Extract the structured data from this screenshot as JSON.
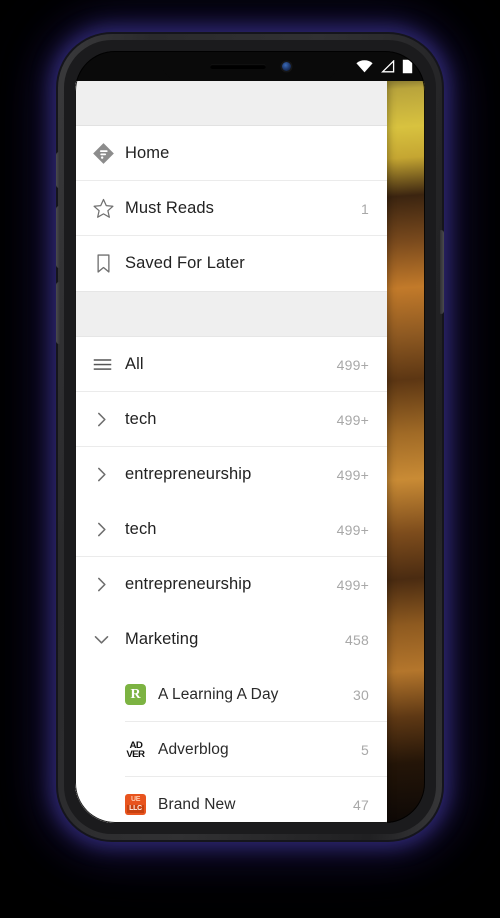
{
  "status_bar": {
    "icons": [
      "wifi-icon",
      "signal-icon",
      "battery-icon"
    ]
  },
  "drawer": {
    "top_items": [
      {
        "label": "Home",
        "count": "",
        "icon": "feedly-logo-icon"
      },
      {
        "label": "Must Reads",
        "count": "1",
        "icon": "star-icon"
      },
      {
        "label": "Saved For Later",
        "count": "",
        "icon": "bookmark-icon"
      }
    ],
    "feed_items": [
      {
        "label": "All",
        "count": "499+",
        "icon": "hamburger-icon"
      },
      {
        "label": "tech",
        "count": "499+",
        "icon": "chevron-right-icon"
      },
      {
        "label": "entrepreneurship",
        "count": "499+",
        "icon": "chevron-right-icon"
      },
      {
        "label": "tech",
        "count": "499+",
        "icon": "chevron-right-icon"
      },
      {
        "label": "entrepreneurship",
        "count": "499+",
        "icon": "chevron-right-icon"
      },
      {
        "label": "Marketing",
        "count": "458",
        "icon": "chevron-down-icon"
      }
    ],
    "marketing_sources": [
      {
        "label": "A Learning A Day",
        "count": "30",
        "icon": "a-learning-a-day-favicon",
        "favicon_text": "R",
        "favicon_color": "#7cb342"
      },
      {
        "label": "Adverblog",
        "count": "5",
        "icon": "adverblog-favicon",
        "favicon_line1": "AD",
        "favicon_line2": "VER",
        "favicon_color": "#111111"
      },
      {
        "label": "Brand New",
        "count": "47",
        "icon": "brand-new-favicon",
        "favicon_line1": "UE",
        "favicon_line2": "LLC",
        "favicon_color": "#e8541e"
      }
    ]
  },
  "colors": {
    "header_gray": "#efefef",
    "divider": "#ebebeb",
    "count_text": "#a8a8a8",
    "label_text": "#222222",
    "drawer_bg": "#ffffff"
  }
}
